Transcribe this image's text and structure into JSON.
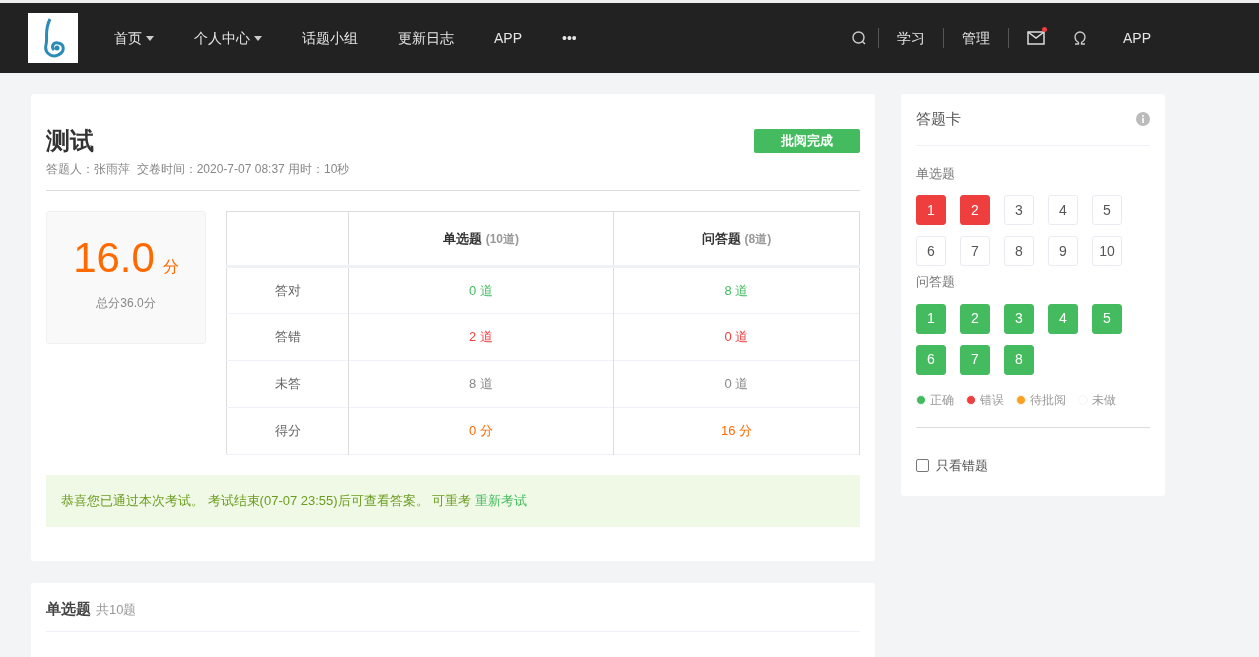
{
  "nav": {
    "items": [
      {
        "label": "首页",
        "dropdown": true
      },
      {
        "label": "个人中心",
        "dropdown": true
      },
      {
        "label": "话题小组",
        "dropdown": false
      },
      {
        "label": "更新日志",
        "dropdown": false
      },
      {
        "label": "APP",
        "dropdown": false
      },
      {
        "label": "•••",
        "dropdown": false
      }
    ],
    "right": [
      {
        "label": "学习"
      },
      {
        "label": "管理"
      }
    ],
    "mail_unread": true,
    "app_label": "APP"
  },
  "exam": {
    "title": "测试",
    "status_button": "批阅完成",
    "meta": "答题人：张雨萍  交卷时间：2020-7-07 08:37 用时：10秒",
    "score": {
      "value": "16.0",
      "unit": "分",
      "total": "总分36.0分"
    },
    "table": {
      "columns": [
        {
          "title": "单选题",
          "count": "(10道)"
        },
        {
          "title": "问答题",
          "count": "(8道)"
        }
      ],
      "rows": [
        {
          "kind": "correct",
          "label": "答对",
          "cells": [
            "0 道",
            "8 道"
          ]
        },
        {
          "kind": "wrong",
          "label": "答错",
          "cells": [
            "2 道",
            "0 道"
          ]
        },
        {
          "kind": "unanswered",
          "label": "未答",
          "cells": [
            "8 道",
            "0 道"
          ]
        },
        {
          "kind": "score",
          "label": "得分",
          "cells": [
            "0 分",
            "16 分"
          ]
        }
      ]
    },
    "notice": {
      "text": "恭喜您已通过本次考试。 考试结束(07-07 23:55)后可查看答案。 可重考",
      "link": "重新考试"
    }
  },
  "section": {
    "title": "单选题",
    "count": "共10题"
  },
  "answer_card": {
    "title": "答题卡",
    "groups": [
      {
        "title": "单选题",
        "items": [
          {
            "label": "1",
            "kind": "wrong"
          },
          {
            "label": "2",
            "kind": "wrong"
          },
          {
            "label": "3",
            "kind": "unanswered"
          },
          {
            "label": "4",
            "kind": "unanswered"
          },
          {
            "label": "5",
            "kind": "unanswered"
          },
          {
            "label": "6",
            "kind": "unanswered"
          },
          {
            "label": "7",
            "kind": "unanswered"
          },
          {
            "label": "8",
            "kind": "unanswered"
          },
          {
            "label": "9",
            "kind": "unanswered"
          },
          {
            "label": "10",
            "kind": "unanswered"
          }
        ]
      },
      {
        "title": "问答题",
        "items": [
          {
            "label": "1",
            "kind": "correct"
          },
          {
            "label": "2",
            "kind": "correct"
          },
          {
            "label": "3",
            "kind": "correct"
          },
          {
            "label": "4",
            "kind": "correct"
          },
          {
            "label": "5",
            "kind": "correct"
          },
          {
            "label": "6",
            "kind": "correct"
          },
          {
            "label": "7",
            "kind": "correct"
          },
          {
            "label": "8",
            "kind": "correct"
          }
        ]
      }
    ],
    "legend": [
      {
        "label": "正确",
        "color": "#45bb5f"
      },
      {
        "label": "错误",
        "color": "#ee3e3e"
      },
      {
        "label": "待批阅",
        "color": "#fca020"
      },
      {
        "label": "未做",
        "color": "#ffffff"
      }
    ],
    "wrong_only": {
      "label": "只看错题",
      "checked": false
    }
  }
}
